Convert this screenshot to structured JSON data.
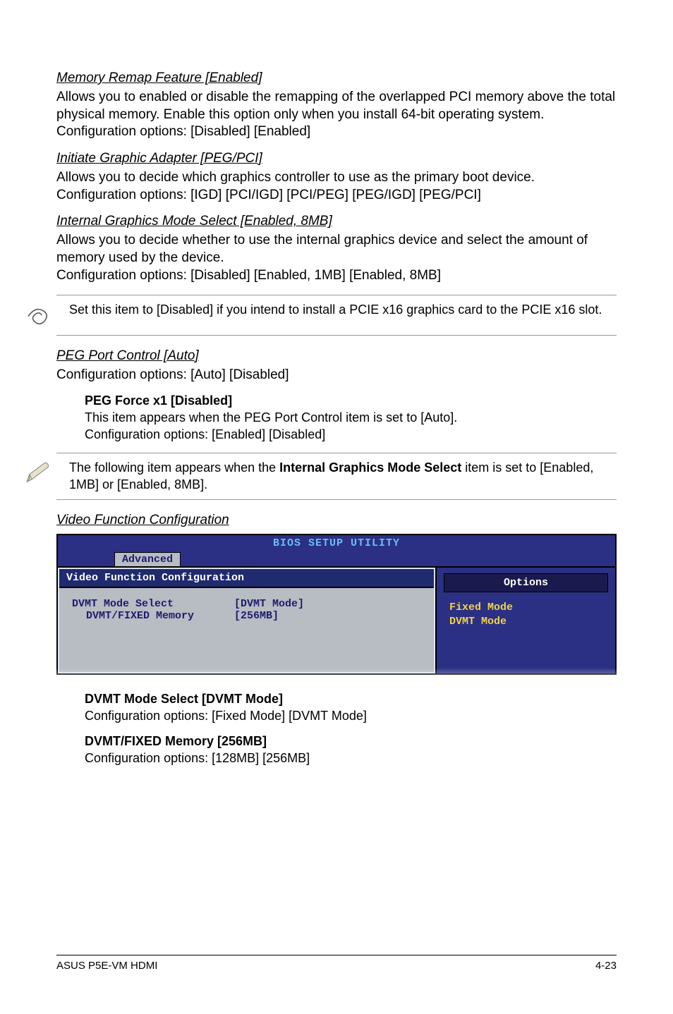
{
  "s1": {
    "heading": "Memory Remap Feature [Enabled]",
    "body": "Allows you to enabled or disable the remapping of the overlapped PCI memory above the total physical memory. Enable this option only when you install 64-bit operating system. Configuration options: [Disabled] [Enabled]"
  },
  "s2": {
    "heading": "Initiate Graphic Adapter [PEG/PCI]",
    "body": "Allows you to decide which graphics controller to use as the primary boot device. Configuration options: [IGD] [PCI/IGD] [PCI/PEG] [PEG/IGD] [PEG/PCI]"
  },
  "s3": {
    "heading": "Internal Graphics Mode Select [Enabled, 8MB]",
    "body1": "Allows you to decide whether to use the internal graphics device and select the amount of memory used by the device.",
    "body2": "Configuration options: [Disabled] [Enabled, 1MB] [Enabled, 8MB]"
  },
  "note1": "Set this item to [Disabled] if you intend to install a PCIE x16 graphics card to the PCIE x16 slot.",
  "s4": {
    "heading": "PEG Port Control [Auto]",
    "body": "Configuration options: [Auto] [Disabled]"
  },
  "sub1": {
    "title": "PEG Force x1 [Disabled]",
    "l1": "This item appears when the PEG Port Control item is set to [Auto].",
    "l2": "Configuration options: [Enabled] [Disabled]"
  },
  "note2": {
    "pre": "The following item appears when the ",
    "bold": "Internal Graphics Mode Select",
    "post": " item is set to [Enabled, 1MB] or [Enabled, 8MB]."
  },
  "s5": {
    "heading": "Video Function Configuration"
  },
  "bios": {
    "title": "BIOS SETUP UTILITY",
    "tab": "Advanced",
    "left_title": "Video Function Configuration",
    "row1_label": "DVMT Mode Select",
    "row1_value": "[DVMT Mode]",
    "row2_label": "DVMT/FIXED Memory",
    "row2_value": "[256MB]",
    "options_label": "Options",
    "opt1": "Fixed Mode",
    "opt2": "DVMT Mode"
  },
  "sub2": {
    "title": "DVMT Mode Select [DVMT Mode]",
    "body": "Configuration options: [Fixed Mode] [DVMT Mode]"
  },
  "sub3": {
    "title": "DVMT/FIXED Memory [256MB]",
    "body": "Configuration options: [128MB] [256MB]"
  },
  "footer": {
    "left": "ASUS P5E-VM HDMI",
    "right": "4-23"
  }
}
